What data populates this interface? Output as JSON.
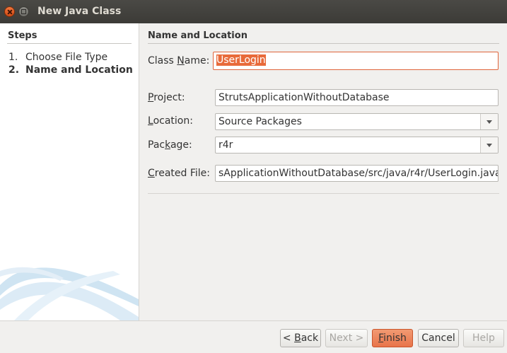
{
  "window": {
    "title": "New Java Class"
  },
  "steps": {
    "title": "Steps",
    "items": [
      {
        "num": "1.",
        "label": "Choose File Type"
      },
      {
        "num": "2.",
        "label": "Name and Location"
      }
    ]
  },
  "form": {
    "section_title": "Name and Location",
    "class_name": {
      "label_pre": "Class ",
      "label_mnemonic": "N",
      "label_post": "ame:",
      "value": "UserLogin"
    },
    "project": {
      "label_mnemonic": "P",
      "label_post": "roject:",
      "value": "StrutsApplicationWithoutDatabase"
    },
    "location": {
      "label_mnemonic": "L",
      "label_post": "ocation:",
      "value": "Source Packages"
    },
    "package": {
      "label_pre": "Pac",
      "label_mnemonic": "k",
      "label_post": "age:",
      "value": "r4r"
    },
    "created_file": {
      "label_mnemonic": "C",
      "label_post": "reated File:",
      "value": "sApplicationWithoutDatabase/src/java/r4r/UserLogin.java"
    }
  },
  "buttons": {
    "back": {
      "pre": "< ",
      "mnemonic": "B",
      "post": "ack"
    },
    "next": "Next >",
    "finish": {
      "mnemonic": "F",
      "post": "inish"
    },
    "cancel": "Cancel",
    "help": "Help"
  }
}
